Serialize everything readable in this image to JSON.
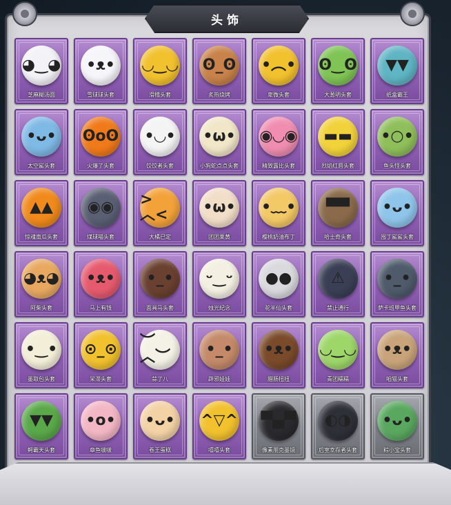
{
  "header": {
    "title": "头饰"
  },
  "items": [
    {
      "label": "芝麻糊汤圆",
      "color": "#f3f3f7",
      "face": "◕‿◕"
    },
    {
      "label": "雪球球头套",
      "color": "#f6f6fa",
      "face": "•ᴥ•"
    },
    {
      "label": "滑稽头套",
      "color": "#f2c12e",
      "face": "◡‿◡"
    },
    {
      "label": "炙热烧烤",
      "color": "#c8824a",
      "face": "ʘ_ʘ"
    },
    {
      "label": "卑微头套",
      "color": "#f2c12e",
      "face": "•︵•"
    },
    {
      "label": "大葱明头套",
      "color": "#7fc455",
      "face": "ʘ‿ʘ"
    },
    {
      "label": "纸盒霸王",
      "color": "#5fb5c4",
      "face": "▼▼"
    },
    {
      "label": "太空鲨头套",
      "color": "#7fb9e6",
      "face": "•ᴗ•"
    },
    {
      "label": "火爆了头套",
      "color": "#f07a1a",
      "face": "ʘoʘ"
    },
    {
      "label": "饺饺者头套",
      "color": "#f4f4f4",
      "face": "•◡•"
    },
    {
      "label": "小狗蛇点点头套",
      "color": "#f1e6c8",
      "face": "•ω•"
    },
    {
      "label": "精致露比头套",
      "color": "#f08db0",
      "face": "◉◡◉"
    },
    {
      "label": "烈焰红唇头套",
      "color": "#f2d23a",
      "face": "▬▬"
    },
    {
      "label": "鱼头怪头套",
      "color": "#8fbf5a",
      "face": "•○•"
    },
    {
      "label": "惊魂南瓜头套",
      "color": "#f08a1c",
      "face": "▲▲"
    },
    {
      "label": "煤球喵头套",
      "color": "#5a5f73",
      "face": "◉◉"
    },
    {
      "label": "大橘已定",
      "color": "#f3a23a",
      "face": ">︿<"
    },
    {
      "label": "团团栗黄",
      "color": "#f2ddc8",
      "face": "•ω•"
    },
    {
      "label": "樱桃奶油布丁",
      "color": "#f3c866",
      "face": "•﹏•"
    },
    {
      "label": "哈士奇头套",
      "color": "#8a6a4a",
      "face": "▀▀"
    },
    {
      "label": "囤丁鲨鲨头套",
      "color": "#8fc5ea",
      "face": "•ᴗ•"
    },
    {
      "label": "阿柴头套",
      "color": "#e8a860",
      "face": "◕ᴥ◕"
    },
    {
      "label": "马上有钱",
      "color": "#e65a6e",
      "face": "•ᴥ•"
    },
    {
      "label": "面具马头套",
      "color": "#6a4030",
      "face": "•_•"
    },
    {
      "label": "烛光纪念",
      "color": "#f3efe2",
      "face": "ᵕ‿ᵕ"
    },
    {
      "label": "驼半仙头套",
      "color": "#d9d9de",
      "face": "●●"
    },
    {
      "label": "禁止通行",
      "color": "#3a3f55",
      "face": "⚠"
    },
    {
      "label": "萨卡班甲鱼头套",
      "color": "#4f5a6a",
      "face": "•_•"
    },
    {
      "label": "墨取包头套",
      "color": "#f3eed8",
      "face": "•‿•"
    },
    {
      "label": "呆滞头套",
      "color": "#f2c12e",
      "face": "⊙_⊙"
    },
    {
      "label": "蒜了八",
      "color": "#f4f1e6",
      "face": "︶︿︶"
    },
    {
      "label": "辟邪娃娃",
      "color": "#c48a6a",
      "face": "•_•"
    },
    {
      "label": "腊肠扭扭",
      "color": "#7a4a2a",
      "face": "•ᴥ•"
    },
    {
      "label": "青团糯糯",
      "color": "#9ed66a",
      "face": "◡‿◡"
    },
    {
      "label": "咱猫头套",
      "color": "#c9a47a",
      "face": "•ᴥ•"
    },
    {
      "label": "鳄霸天头套",
      "color": "#5aa84a",
      "face": "▼▼"
    },
    {
      "label": "章鱼啵啵",
      "color": "#f3b6c4",
      "face": "•o•"
    },
    {
      "label": "卷王蛋糕",
      "color": "#f3d2a6",
      "face": "•ᴗ•"
    },
    {
      "label": "嘻嘻头套",
      "color": "#f2c12e",
      "face": "^▽^"
    },
    {
      "label": "像素朋克墨镜",
      "color": "#2a2a2e",
      "face": "▀▄▀",
      "gray": true
    },
    {
      "label": "后室幸存者头套",
      "color": "#2e3038",
      "face": "◐◑",
      "gray": true
    },
    {
      "label": "粽小宝头套",
      "color": "#5aa860",
      "face": "•ᴗ•",
      "gray": true
    }
  ]
}
